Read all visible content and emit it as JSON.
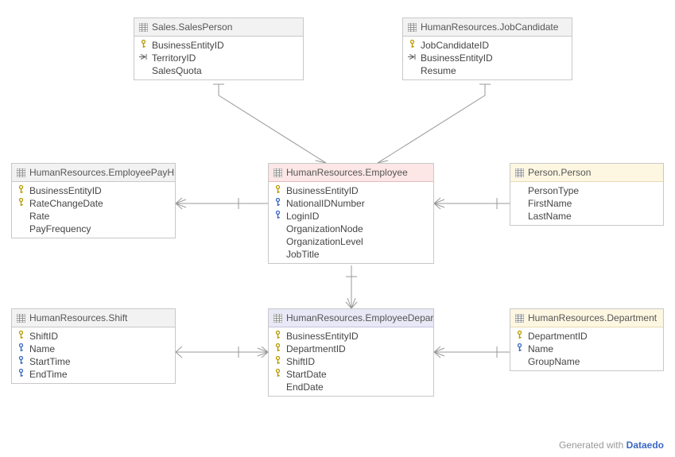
{
  "footer": {
    "text": "Generated with ",
    "brand": "Dataedo"
  },
  "entities": {
    "salesperson": {
      "title": "Sales.SalesPerson",
      "cols": [
        {
          "icon": "pk",
          "name": "BusinessEntityID"
        },
        {
          "icon": "fk",
          "name": "TerritoryID"
        },
        {
          "icon": "",
          "name": "SalesQuota"
        }
      ]
    },
    "jobcandidate": {
      "title": "HumanResources.JobCandidate",
      "cols": [
        {
          "icon": "pk",
          "name": "JobCandidateID"
        },
        {
          "icon": "fk",
          "name": "BusinessEntityID"
        },
        {
          "icon": "",
          "name": "Resume"
        }
      ]
    },
    "payhist": {
      "title": "HumanResources.EmployeePayHi...",
      "cols": [
        {
          "icon": "pk",
          "name": "BusinessEntityID"
        },
        {
          "icon": "pk",
          "name": "RateChangeDate"
        },
        {
          "icon": "",
          "name": "Rate"
        },
        {
          "icon": "",
          "name": "PayFrequency"
        }
      ]
    },
    "employee": {
      "title": "HumanResources.Employee",
      "cols": [
        {
          "icon": "pk",
          "name": "BusinessEntityID"
        },
        {
          "icon": "uk",
          "name": "NationalIDNumber"
        },
        {
          "icon": "uk",
          "name": "LoginID"
        },
        {
          "icon": "",
          "name": "OrganizationNode"
        },
        {
          "icon": "",
          "name": "OrganizationLevel"
        },
        {
          "icon": "",
          "name": "JobTitle"
        }
      ]
    },
    "person": {
      "title": "Person.Person",
      "cols": [
        {
          "icon": "",
          "name": "PersonType"
        },
        {
          "icon": "",
          "name": "FirstName"
        },
        {
          "icon": "",
          "name": "LastName"
        }
      ]
    },
    "shift": {
      "title": "HumanResources.Shift",
      "cols": [
        {
          "icon": "pk",
          "name": "ShiftID"
        },
        {
          "icon": "uk",
          "name": "Name"
        },
        {
          "icon": "uk",
          "name": "StartTime"
        },
        {
          "icon": "uk",
          "name": "EndTime"
        }
      ]
    },
    "empdept": {
      "title": "HumanResources.EmployeeDepar...",
      "cols": [
        {
          "icon": "pk",
          "name": "BusinessEntityID"
        },
        {
          "icon": "pk",
          "name": "DepartmentID"
        },
        {
          "icon": "pk",
          "name": "ShiftID"
        },
        {
          "icon": "pk",
          "name": "StartDate"
        },
        {
          "icon": "",
          "name": "EndDate"
        }
      ]
    },
    "department": {
      "title": "HumanResources.Department",
      "cols": [
        {
          "icon": "pk",
          "name": "DepartmentID"
        },
        {
          "icon": "uk",
          "name": "Name"
        },
        {
          "icon": "",
          "name": "GroupName"
        }
      ]
    }
  }
}
